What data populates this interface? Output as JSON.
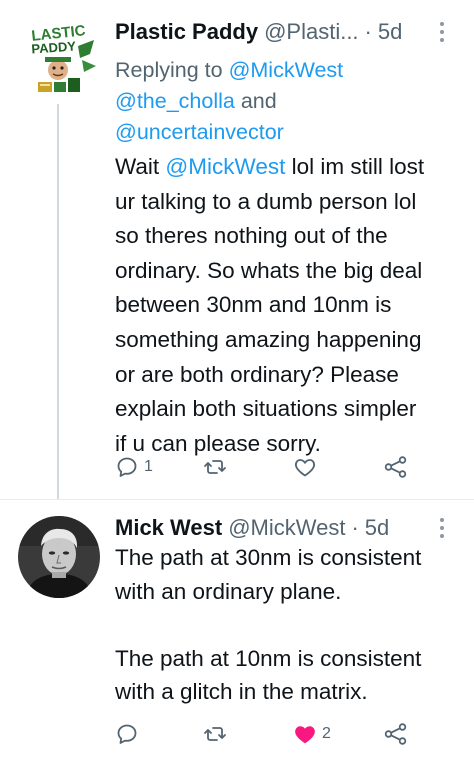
{
  "tweets": [
    {
      "avatar_lettering": "PLASTIC PADDY",
      "display_name": "Plastic Paddy",
      "handle": "@Plasti...",
      "separator": "·",
      "age": "5d",
      "replying_prefix": "Replying to",
      "replying_mentions": [
        "@MickWest",
        "@the_cholla",
        "@uncertainvector"
      ],
      "replying_and": "and",
      "body_lines": [
        {
          "pre": "Wait ",
          "mention": "@MickWest",
          "post": " lol im still lost"
        },
        {
          "pre": "ur talking to a dumb person lol",
          "mention": "",
          "post": ""
        },
        {
          "pre": "so theres nothing out of the",
          "mention": "",
          "post": ""
        },
        {
          "pre": "ordinary. So whats the big deal",
          "mention": "",
          "post": ""
        },
        {
          "pre": "between 30nm and 10nm is",
          "mention": "",
          "post": ""
        },
        {
          "pre": "something amazing happening",
          "mention": "",
          "post": ""
        },
        {
          "pre": "or are both ordinary? Please",
          "mention": "",
          "post": ""
        },
        {
          "pre": "explain both situations simpler",
          "mention": "",
          "post": ""
        },
        {
          "pre": "if u can please sorry.",
          "mention": "",
          "post": ""
        }
      ],
      "reply_count": "1",
      "retweet_count": "",
      "like_count": "",
      "liked": false
    },
    {
      "display_name": "Mick West",
      "handle": "@MickWest",
      "separator": "·",
      "age": "5d",
      "body_lines": [
        "The path at 30nm is consistent",
        "with an ordinary plane.",
        "",
        "The path at 10nm is consistent",
        "with a glitch in the matrix."
      ],
      "reply_count": "",
      "retweet_count": "",
      "like_count": "2",
      "liked": true
    }
  ],
  "icons": {
    "reply": "reply-bubble-icon",
    "retweet": "retweet-icon",
    "like": "heart-icon",
    "share": "share-icon",
    "more": "more-options-icon"
  },
  "colors": {
    "text": "#0f1419",
    "secondary": "#536471",
    "link": "#1d9bf0",
    "like": "#f91880",
    "divider": "#e6ecf0",
    "thread_line": "#cfd9de"
  }
}
